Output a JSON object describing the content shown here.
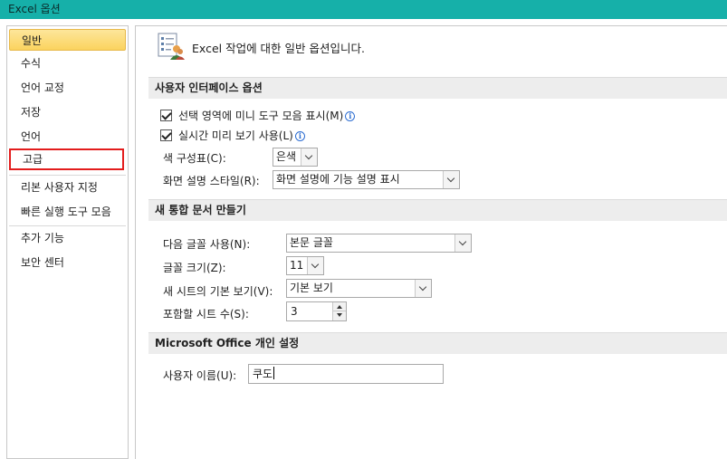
{
  "window": {
    "title": "Excel 옵션"
  },
  "sidebar": {
    "items": [
      {
        "label": "일반"
      },
      {
        "label": "수식"
      },
      {
        "label": "언어 교정"
      },
      {
        "label": "저장"
      },
      {
        "label": "언어"
      },
      {
        "label": "고급"
      },
      {
        "label": "리본 사용자 지정"
      },
      {
        "label": "빠른 실행 도구 모음"
      },
      {
        "label": "추가 기능"
      },
      {
        "label": "보안 센터"
      }
    ],
    "selected": "일반"
  },
  "main": {
    "header": "Excel 작업에 대한 일반 옵션입니다.",
    "ui_section": {
      "title": "사용자 인터페이스 옵션",
      "mini_toolbar": {
        "label": "선택 영역에 미니 도구 모음 표시(M)",
        "checked": true
      },
      "live_preview": {
        "label": "실시간 미리 보기 사용(L)",
        "checked": true
      },
      "color_scheme": {
        "label": "색 구성표(C):",
        "value": "은색"
      },
      "screentip": {
        "label": "화면 설명 스타일(R):",
        "value": "화면 설명에 기능 설명 표시"
      }
    },
    "workbook_section": {
      "title": "새 통합 문서 만들기",
      "font": {
        "label": "다음 글꼴 사용(N):",
        "value": "본문 글꼴"
      },
      "font_size": {
        "label": "글꼴 크기(Z):",
        "value": "11"
      },
      "default_view": {
        "label": "새 시트의 기본 보기(V):",
        "value": "기본 보기"
      },
      "sheet_count": {
        "label": "포함할 시트 수(S):",
        "value": "3"
      }
    },
    "personal_section": {
      "title": "Microsoft Office 개인 설정",
      "username": {
        "label": "사용자 이름(U):",
        "value": "쿠도"
      }
    }
  },
  "icons": {
    "info": "i"
  }
}
